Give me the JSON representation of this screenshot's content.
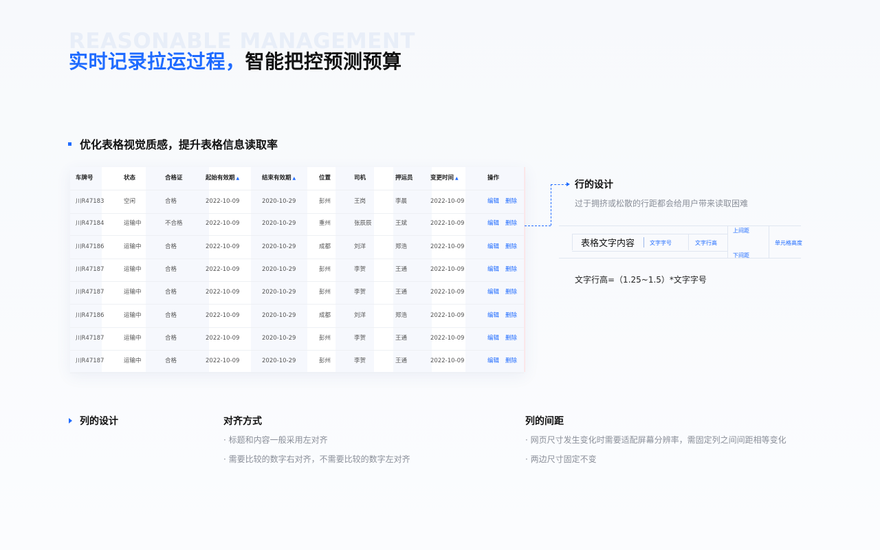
{
  "background_word": "REASONABLE MANAGEMENT",
  "headline": {
    "blue": "实时记录拉运过程，",
    "dark": "智能把控预测预算"
  },
  "section_title": "优化表格视觉质感，提升表格信息读取率",
  "table": {
    "headers": [
      "车牌号",
      "状态",
      "合格证",
      "起始有效期",
      "结束有效期",
      "位置",
      "司机",
      "押运员",
      "变更时间",
      "操作"
    ],
    "sortable": [
      false,
      false,
      false,
      true,
      true,
      false,
      false,
      false,
      true,
      false
    ],
    "sort_glyph": "▲",
    "actions": {
      "edit": "编辑",
      "delete": "删除"
    },
    "rows": [
      [
        "川R47183",
        "空闲",
        "合格",
        "2022-10-09",
        "2020-10-29",
        "彭州",
        "王岗",
        "李晨",
        "2022-10-09"
      ],
      [
        "川R47184",
        "运输中",
        "不合格",
        "2022-10-09",
        "2020-10-29",
        "重州",
        "张辰辰",
        "王斌",
        "2022-10-09"
      ],
      [
        "川R47186",
        "运输中",
        "合格",
        "2022-10-09",
        "2020-10-29",
        "成都",
        "刘洋",
        "郑浩",
        "2022-10-09"
      ],
      [
        "川R47187",
        "运输中",
        "合格",
        "2022-10-09",
        "2020-10-29",
        "彭州",
        "李贺",
        "王通",
        "2022-10-09"
      ],
      [
        "川R47187",
        "运输中",
        "合格",
        "2022-10-09",
        "2020-10-29",
        "彭州",
        "李贺",
        "王通",
        "2022-10-09"
      ],
      [
        "川R47186",
        "运输中",
        "合格",
        "2022-10-09",
        "2020-10-29",
        "成都",
        "刘洋",
        "郑浩",
        "2022-10-09"
      ],
      [
        "川R47187",
        "运输中",
        "合格",
        "2022-10-09",
        "2020-10-29",
        "彭州",
        "李贺",
        "王通",
        "2022-10-09"
      ],
      [
        "川R47187",
        "运输中",
        "合格",
        "2022-10-09",
        "2020-10-29",
        "彭州",
        "李贺",
        "王通",
        "2022-10-09"
      ]
    ]
  },
  "row_design": {
    "title": "行的设计",
    "desc": "过于拥挤或松散的行距都会给用户带来读取困难",
    "diagram": {
      "content": "表格文字内容",
      "font_size": "文字字号",
      "line_height": "文字行高",
      "top_spacing": "上间距",
      "bottom_spacing": "下间距",
      "cell_height": "单元格高度"
    },
    "formula": "文字行高=（1.25~1.5）*文字字号"
  },
  "column_design": {
    "title": "列的设计",
    "alignment": {
      "title": "对齐方式",
      "items": [
        "· 标题和内容一般采用左对齐",
        "· 需要比较的数字右对齐，不需要比较的数字左对齐"
      ]
    },
    "spacing": {
      "title": "列的间距",
      "items": [
        "· 网页尺寸发生变化时需要适配屏幕分辨率，需固定列之间间距相等变化",
        "· 两边尺寸固定不变"
      ]
    }
  },
  "colors": {
    "accent": "#1f6bff",
    "text": "#111111",
    "muted": "#8a8f99"
  }
}
